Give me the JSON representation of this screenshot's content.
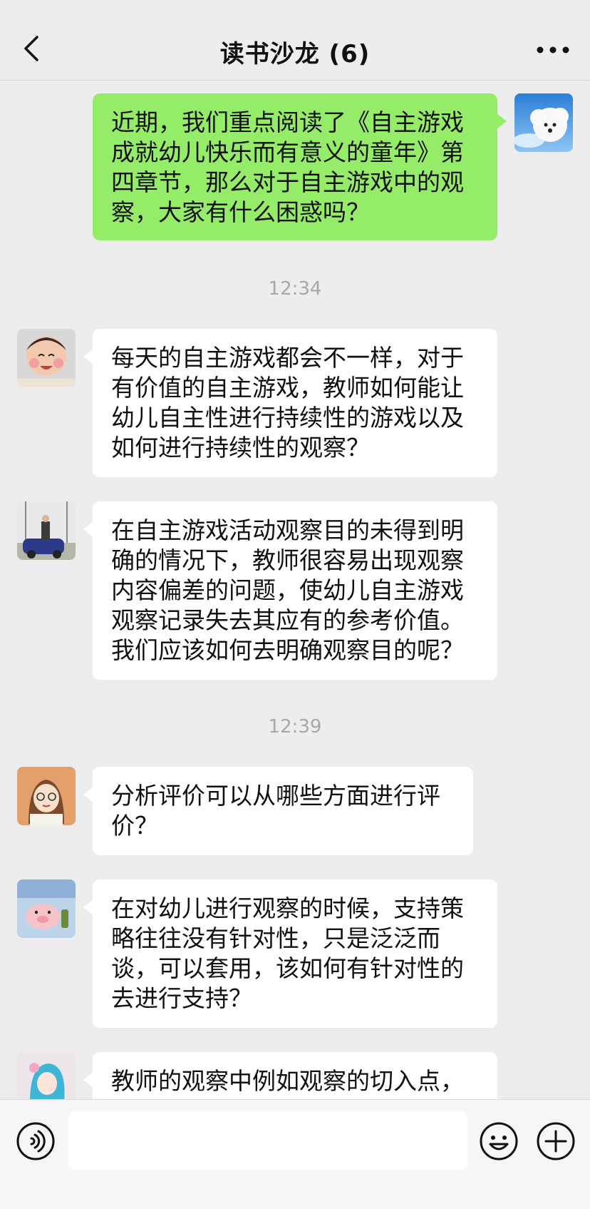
{
  "header": {
    "title": "读书沙龙 (6)"
  },
  "messages": [
    {
      "side": "mine",
      "text": "近期，我们重点阅读了《自主游戏成就幼儿快乐而有意义的童年》第四章节，那么对于自主游戏中的观察，大家有什么困惑吗？"
    },
    {
      "side": "theirs",
      "text": "每天的自主游戏都会不一样，对于有价值的自主游戏，教师如何能让幼儿自主性进行持续性的游戏以及如何进行持续性的观察？"
    },
    {
      "side": "theirs",
      "text": "在自主游戏活动观察目的未得到明确的情况下，教师很容易出现观察内容偏差的问题，使幼儿自主游戏观察记录失去其应有的参考价值。我们应该如何去明确观察目的呢？"
    },
    {
      "side": "theirs",
      "text": "分析评价可以从哪些方面进行评价？"
    },
    {
      "side": "theirs",
      "text": "在对幼儿进行观察的时候，支持策略往往没有针对性，只是泛泛而谈，可以套用，该如何有针对性的去进行支持？"
    },
    {
      "side": "theirs",
      "text": "教师的观察中例如观察的切入点，"
    }
  ],
  "timestamps": [
    "12:34",
    "12:39"
  ],
  "icons": {
    "back": "chevron-left-icon",
    "more": "more-dots-icon",
    "voice": "voice-icon",
    "emoji": "emoji-icon",
    "plus": "plus-icon"
  },
  "colors": {
    "mine_bubble": "#95ec69",
    "theirs_bubble": "#ffffff",
    "background": "#ededed"
  },
  "composer": {
    "placeholder": ""
  }
}
